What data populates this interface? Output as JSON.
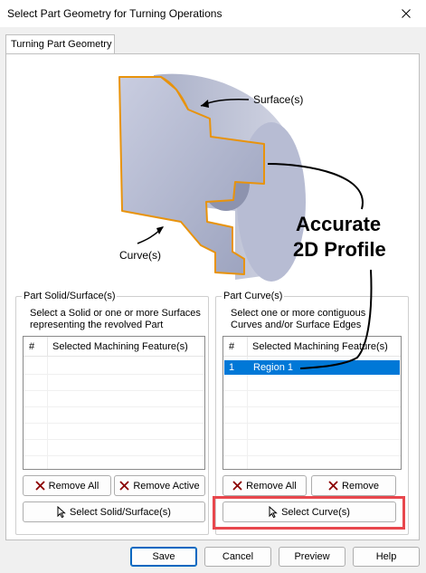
{
  "window": {
    "title": "Select Part Geometry for Turning Operations"
  },
  "tab": {
    "label": "Turning Part Geometry"
  },
  "illustration": {
    "surface_label": "Surface(s)",
    "curve_label": "Curve(s)",
    "callout_line1": "Accurate",
    "callout_line2": "2D Profile",
    "colors": {
      "profile": "#e8930c",
      "part": "#b9bfd6",
      "callout": "#000000"
    }
  },
  "left_group": {
    "label": "Part Solid/Surface(s)",
    "desc_line1": "Select a Solid or one or more Surfaces",
    "desc_line2": "representing the revolved Part",
    "list": {
      "hash": "#",
      "column": "Selected Machining Feature(s)"
    },
    "remove_all": "Remove All",
    "remove_active": "Remove Active",
    "select": "Select Solid/Surface(s)"
  },
  "right_group": {
    "label": "Part Curve(s)",
    "desc_line1": "Select one or more contiguous",
    "desc_line2": "Curves and/or Surface Edges",
    "list": {
      "hash": "#",
      "column": "Selected Machining Feature(s)",
      "rows": [
        {
          "index": "1",
          "name": "Region 1"
        }
      ]
    },
    "remove_all": "Remove All",
    "remove": "Remove",
    "select": "Select Curve(s)"
  },
  "footer": {
    "save": "Save",
    "cancel": "Cancel",
    "preview": "Preview",
    "help": "Help"
  },
  "colors": {
    "selection": "#0078d7",
    "highlight": "#e8474d",
    "remove_icon": "#8b0000"
  }
}
